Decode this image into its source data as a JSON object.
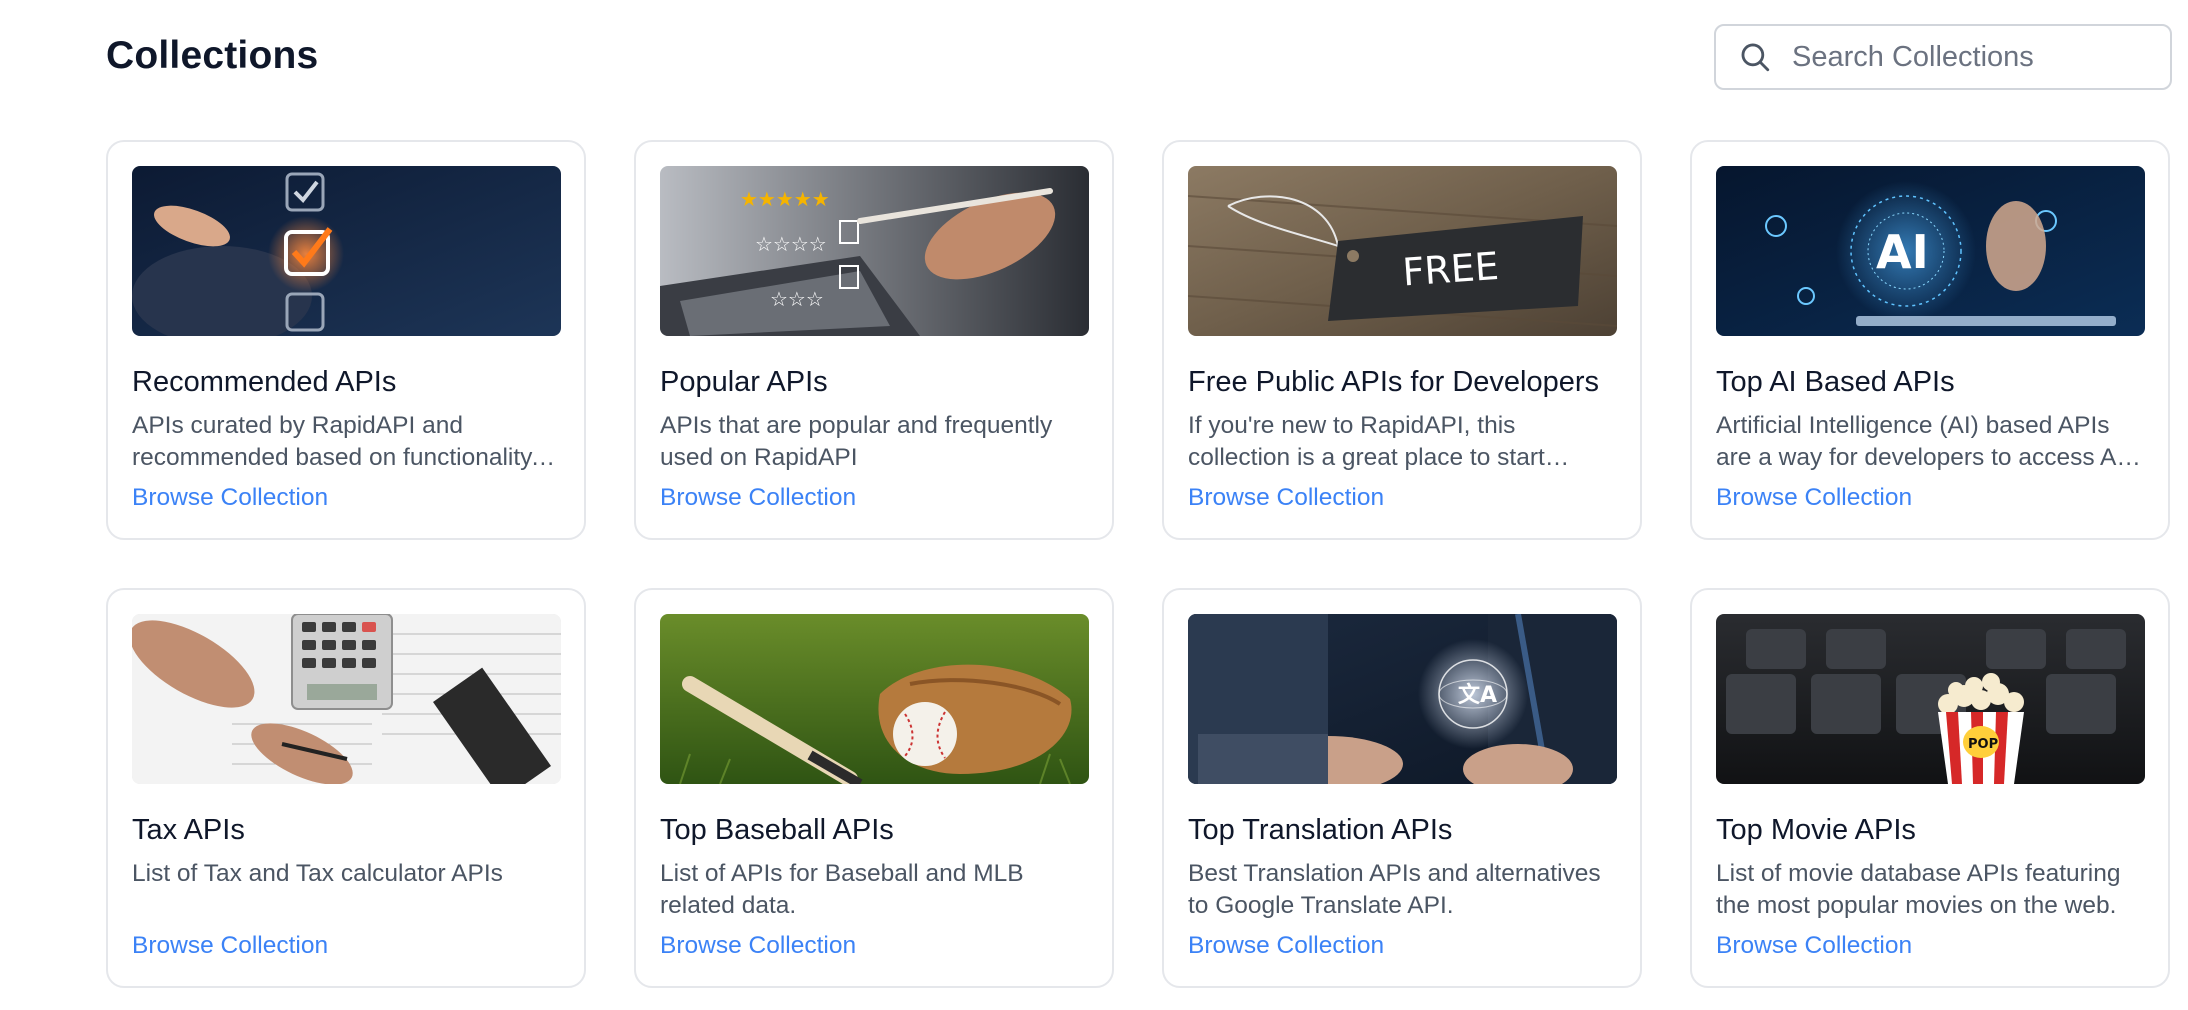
{
  "header": {
    "title": "Collections",
    "search_placeholder": "Search Collections"
  },
  "cards": [
    {
      "title": "Recommended APIs",
      "description": "APIs curated by RapidAPI and recommended based on functionality, performance, and support",
      "link": "Browse Collection",
      "image": "checklist-image"
    },
    {
      "title": "Popular APIs",
      "description": "APIs that are popular and frequently used on RapidAPI",
      "link": "Browse Collection",
      "image": "rating-image"
    },
    {
      "title": "Free Public APIs for Developers",
      "description": "If you're new to RapidAPI, this collection is a great place to start exploring",
      "link": "Browse Collection",
      "image": "free-tag-image"
    },
    {
      "title": "Top AI Based APIs",
      "description": "Artificial Intelligence (AI) based APIs are a way for developers to access AI capabilities",
      "link": "Browse Collection",
      "image": "ai-image"
    },
    {
      "title": "Tax APIs",
      "description": "List of Tax and Tax calculator APIs",
      "link": "Browse Collection",
      "image": "calculator-image"
    },
    {
      "title": "Top Baseball APIs",
      "description": "List of APIs for Baseball and MLB related data.",
      "link": "Browse Collection",
      "image": "baseball-image"
    },
    {
      "title": "Top Translation APIs",
      "description": "Best Translation APIs and alternatives to Google Translate API.",
      "link": "Browse Collection",
      "image": "translation-image"
    },
    {
      "title": "Top Movie APIs",
      "description": "List of movie database APIs featuring the most popular movies on the web.",
      "link": "Browse Collection",
      "image": "popcorn-image"
    }
  ]
}
